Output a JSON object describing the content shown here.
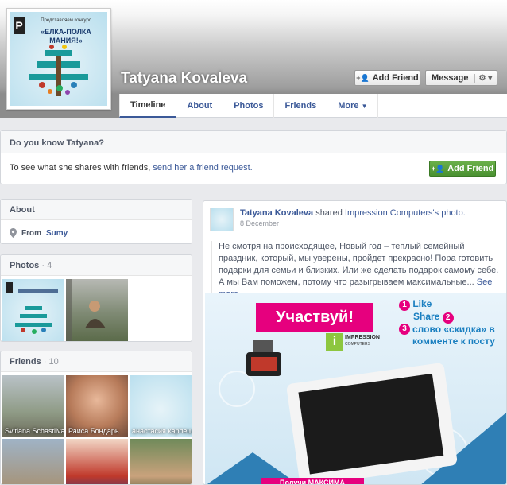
{
  "profile": {
    "name": "Tatyana Kovaleva",
    "pic_text_lines": [
      "Представляем конкурс",
      "«ЕЛКА-ПОЛКА",
      "МАНИЯ!»"
    ]
  },
  "header_buttons": {
    "add_friend": "Add Friend",
    "message": "Message"
  },
  "tabs": [
    {
      "label": "Timeline"
    },
    {
      "label": "About"
    },
    {
      "label": "Photos"
    },
    {
      "label": "Friends"
    },
    {
      "label": "More"
    }
  ],
  "know": {
    "title": "Do you know Tatyana?",
    "text": "To see what she shares with friends,",
    "link": "send her a friend request.",
    "button": "Add Friend"
  },
  "about": {
    "title": "About",
    "from_label": "From",
    "from_value": "Sumy"
  },
  "photos": {
    "title": "Photos",
    "count": "· 4"
  },
  "friends": {
    "title": "Friends",
    "count": "· 10",
    "items": [
      {
        "name": "Svitlana Schastliva"
      },
      {
        "name": "Раиса Бондарь"
      },
      {
        "name": "анастасия карпеш"
      }
    ]
  },
  "post": {
    "author": "Tatyana Kovaleva",
    "action": "shared",
    "source": "Impression Computers",
    "object": "'s photo.",
    "date": "8 December",
    "body": "Не смотря на происходящее, Новый год – теплый семейный праздник, который, мы уверены, пройдет прекрасно! Пора готовить подарки для семьи и близких. Или же сделать подарок самому себе. А мы Вам поможем, потому что разыгрываем максимальные...",
    "see_more": "See more"
  },
  "ad": {
    "headline": "Участвуй!",
    "steps": [
      {
        "num": "1",
        "text": "Like"
      },
      {
        "num": "2",
        "text": "Share"
      },
      {
        "num": "3",
        "text": "слово «скидка» в комменте к посту"
      }
    ],
    "brand_top": "IMPRESSION",
    "brand_bottom": "COMPUTERS",
    "bottom_text": "Получи МАКСИМА"
  },
  "colors": {
    "link": "#3b5998",
    "green": "#4a9131",
    "magenta": "#e6007e"
  }
}
